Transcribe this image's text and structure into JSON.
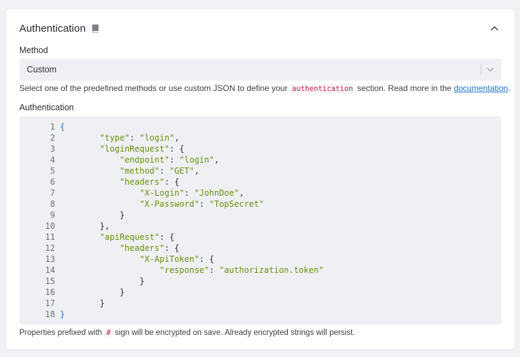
{
  "section": {
    "title": "Authentication",
    "title_icon": "book-icon",
    "collapse_icon": "chevron-up-icon"
  },
  "method": {
    "label": "Method",
    "selected": "Custom",
    "dropdown_icon": "chevron-down-icon"
  },
  "help": {
    "prefix": "Select one of the predefined methods or use custom JSON to define your ",
    "code": "authentication",
    "middle": " section. Read more in the ",
    "link": "documentation",
    "suffix": "."
  },
  "editor": {
    "label": "Authentication",
    "lines": [
      [
        {
          "t": "{",
          "c": "outer"
        }
      ],
      [
        {
          "t": "        "
        },
        {
          "t": "\"type\"",
          "c": "key"
        },
        {
          "t": ": "
        },
        {
          "t": "\"login\"",
          "c": "str"
        },
        {
          "t": ","
        }
      ],
      [
        {
          "t": "        "
        },
        {
          "t": "\"loginRequest\"",
          "c": "key"
        },
        {
          "t": ": {"
        }
      ],
      [
        {
          "t": "            "
        },
        {
          "t": "\"endpoint\"",
          "c": "key"
        },
        {
          "t": ": "
        },
        {
          "t": "\"login\"",
          "c": "str"
        },
        {
          "t": ","
        }
      ],
      [
        {
          "t": "            "
        },
        {
          "t": "\"method\"",
          "c": "key"
        },
        {
          "t": ": "
        },
        {
          "t": "\"GET\"",
          "c": "str"
        },
        {
          "t": ","
        }
      ],
      [
        {
          "t": "            "
        },
        {
          "t": "\"headers\"",
          "c": "key"
        },
        {
          "t": ": {"
        }
      ],
      [
        {
          "t": "                "
        },
        {
          "t": "\"X-Login\"",
          "c": "key"
        },
        {
          "t": ": "
        },
        {
          "t": "\"JohnDoe\"",
          "c": "str"
        },
        {
          "t": ","
        }
      ],
      [
        {
          "t": "                "
        },
        {
          "t": "\"X-Password\"",
          "c": "key"
        },
        {
          "t": ": "
        },
        {
          "t": "\"TopSecret\"",
          "c": "str"
        }
      ],
      [
        {
          "t": "            }"
        }
      ],
      [
        {
          "t": "        },"
        }
      ],
      [
        {
          "t": "        "
        },
        {
          "t": "\"apiRequest\"",
          "c": "key"
        },
        {
          "t": ": {"
        }
      ],
      [
        {
          "t": "            "
        },
        {
          "t": "\"headers\"",
          "c": "key"
        },
        {
          "t": ": {"
        }
      ],
      [
        {
          "t": "                "
        },
        {
          "t": "\"X-ApiToken\"",
          "c": "key"
        },
        {
          "t": ": {"
        }
      ],
      [
        {
          "t": "                    "
        },
        {
          "t": "\"response\"",
          "c": "key"
        },
        {
          "t": ": "
        },
        {
          "t": "\"authorization.token\"",
          "c": "str"
        }
      ],
      [
        {
          "t": "                }"
        }
      ],
      [
        {
          "t": "            }"
        }
      ],
      [
        {
          "t": "        }"
        }
      ],
      [
        {
          "t": "}",
          "c": "outer"
        }
      ]
    ]
  },
  "footnote": {
    "prefix": "Properties prefixed with ",
    "code": "#",
    "suffix": " sign will be encrypted on save. Already encrypted strings will persist."
  },
  "colors": {
    "accent_link": "#1a73c8",
    "json_key": "#6b8e0a",
    "inline_code": "#c7254e",
    "field_bg": "#eff0f3"
  }
}
